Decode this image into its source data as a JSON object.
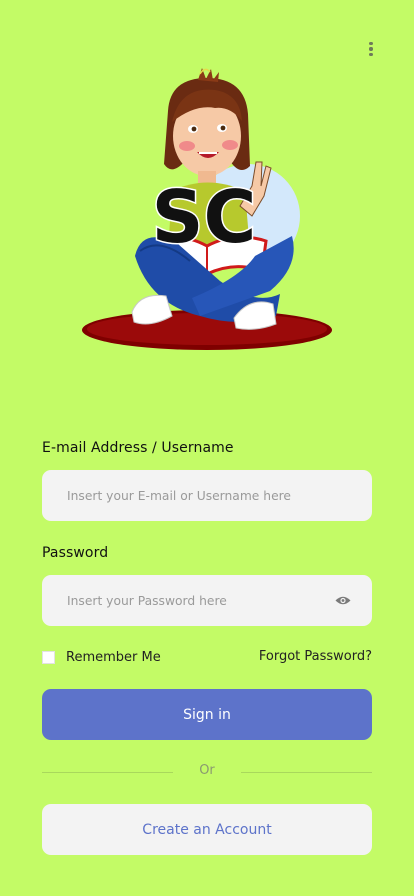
{
  "logo": {
    "text": "SC"
  },
  "form": {
    "email_label": "E-mail Address / Username",
    "email_placeholder": "Insert your E-mail or Username here",
    "password_label": "Password",
    "password_placeholder": "Insert your Password here",
    "remember_label": "Remember Me",
    "forgot_label": "Forgot Password?"
  },
  "actions": {
    "signin_label": "Sign in",
    "divider_label": "Or",
    "create_label": "Create an Account"
  },
  "colors": {
    "background": "#c3fb66",
    "primary": "#5d73ca",
    "input_bg": "#f3f3f3"
  }
}
